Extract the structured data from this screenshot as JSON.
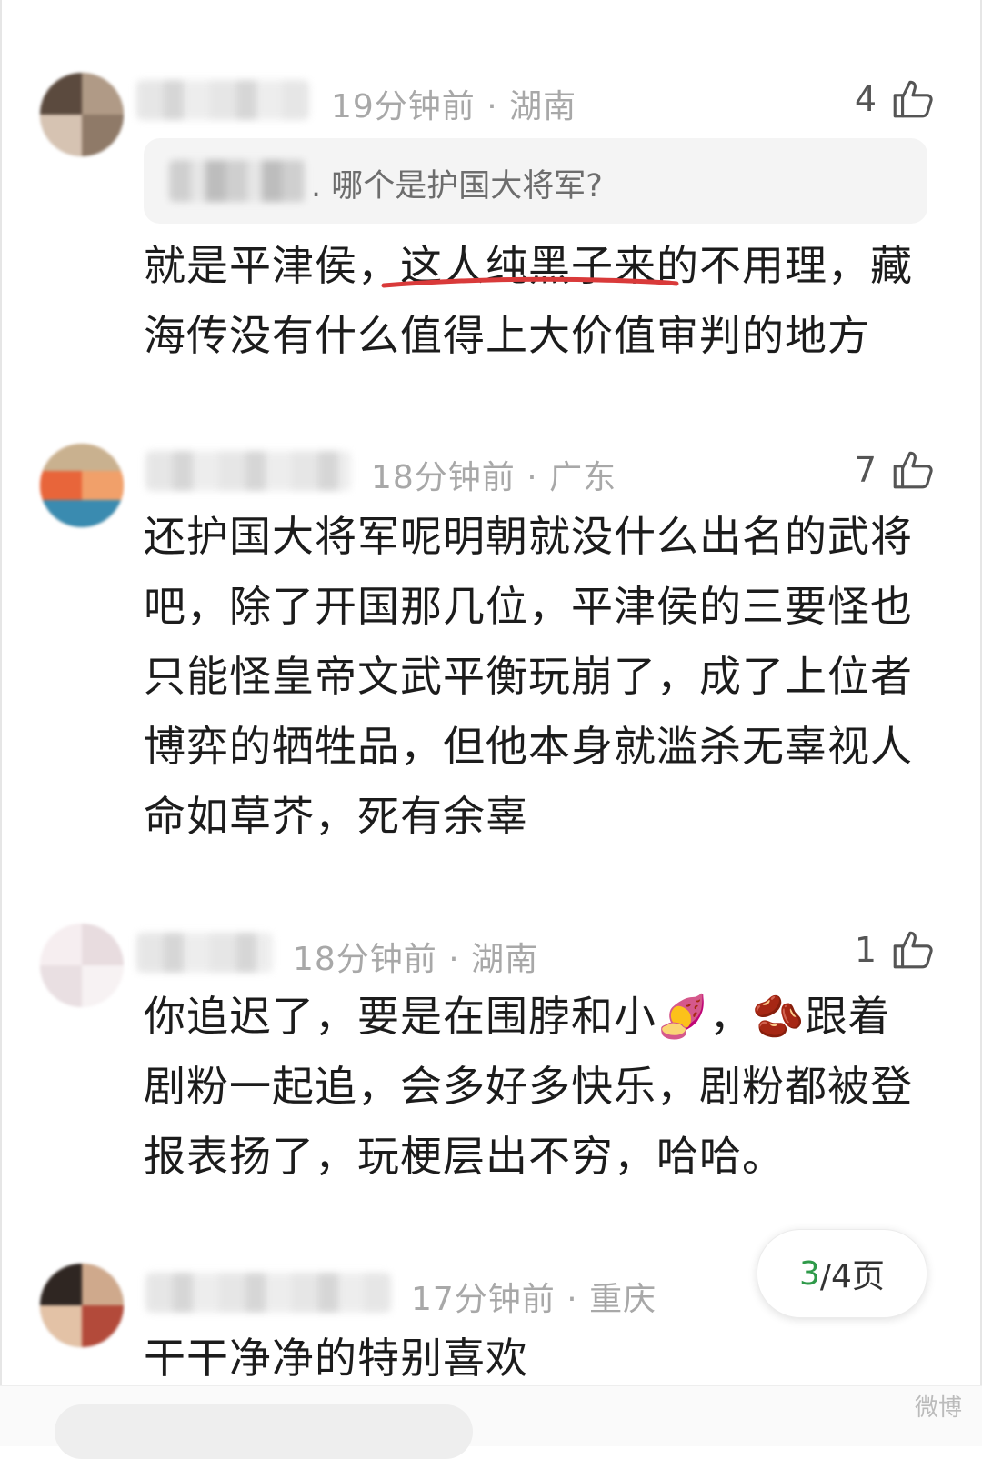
{
  "comments": [
    {
      "time_location": "19分钟前 · 湖南",
      "likes": "4",
      "quote": {
        "text": ". 哪个是护国大将军?"
      },
      "text": "就是平津侯，这人纯黑子来的不用理，藏海传没有什么值得上大价值审判的地方",
      "underline_color": "#d93a3a"
    },
    {
      "time_location": "18分钟前 · 广东",
      "likes": "7",
      "text": "还护国大将军呢明朝就没什么出名的武将吧，除了开国那几位，平津侯的三要怪也只能怪皇帝文武平衡玩崩了，成了上位者博弈的牺牲品，但他本身就滥杀无辜视人命如草芥，死有余辜"
    },
    {
      "time_location": "18分钟前 · 湖南",
      "likes": "1",
      "text_before_emoji1": "你追迟了，要是在围脖和小",
      "text_between": "，",
      "text_after": "跟着剧粉一起追，会多好多快乐，剧粉都被登报表扬了，玩梗层出不穷，哈哈。",
      "emoji1": "🍠",
      "emoji2": "🫘"
    },
    {
      "time_location": "17分钟前 · 重庆",
      "text": "干干净净的特别喜欢"
    }
  ],
  "pager": {
    "current": "3",
    "total_label": "/4页"
  },
  "watermark": "微博",
  "colors": {
    "accent_green": "#2f9a4a",
    "meta_gray": "#a8a8a8"
  }
}
